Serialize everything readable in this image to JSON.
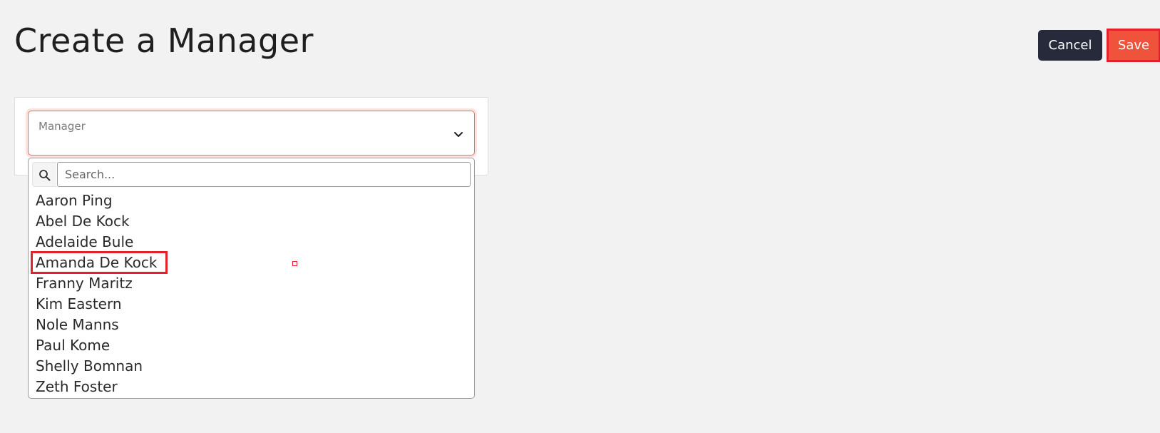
{
  "page": {
    "title": "Create a Manager"
  },
  "actions": {
    "cancel_label": "Cancel",
    "save_label": "Save"
  },
  "manager_field": {
    "label": "Manager",
    "value": "",
    "search_placeholder": "Search...",
    "options": [
      "Aaron Ping",
      "Abel De Kock",
      "Adelaide Bule",
      "Amanda De Kock",
      "Franny Maritz",
      "Kim Eastern",
      "Nole Manns",
      "Paul Kome",
      "Shelly Bomnan",
      "Zeth Foster"
    ],
    "highlighted_option": "Amanda De Kock"
  },
  "colors": {
    "background": "#f2f2f2",
    "cancel_button": "#262a3b",
    "save_button": "#f0533b",
    "highlight_outline": "#e3202c",
    "focus_border": "#f26b5b"
  }
}
